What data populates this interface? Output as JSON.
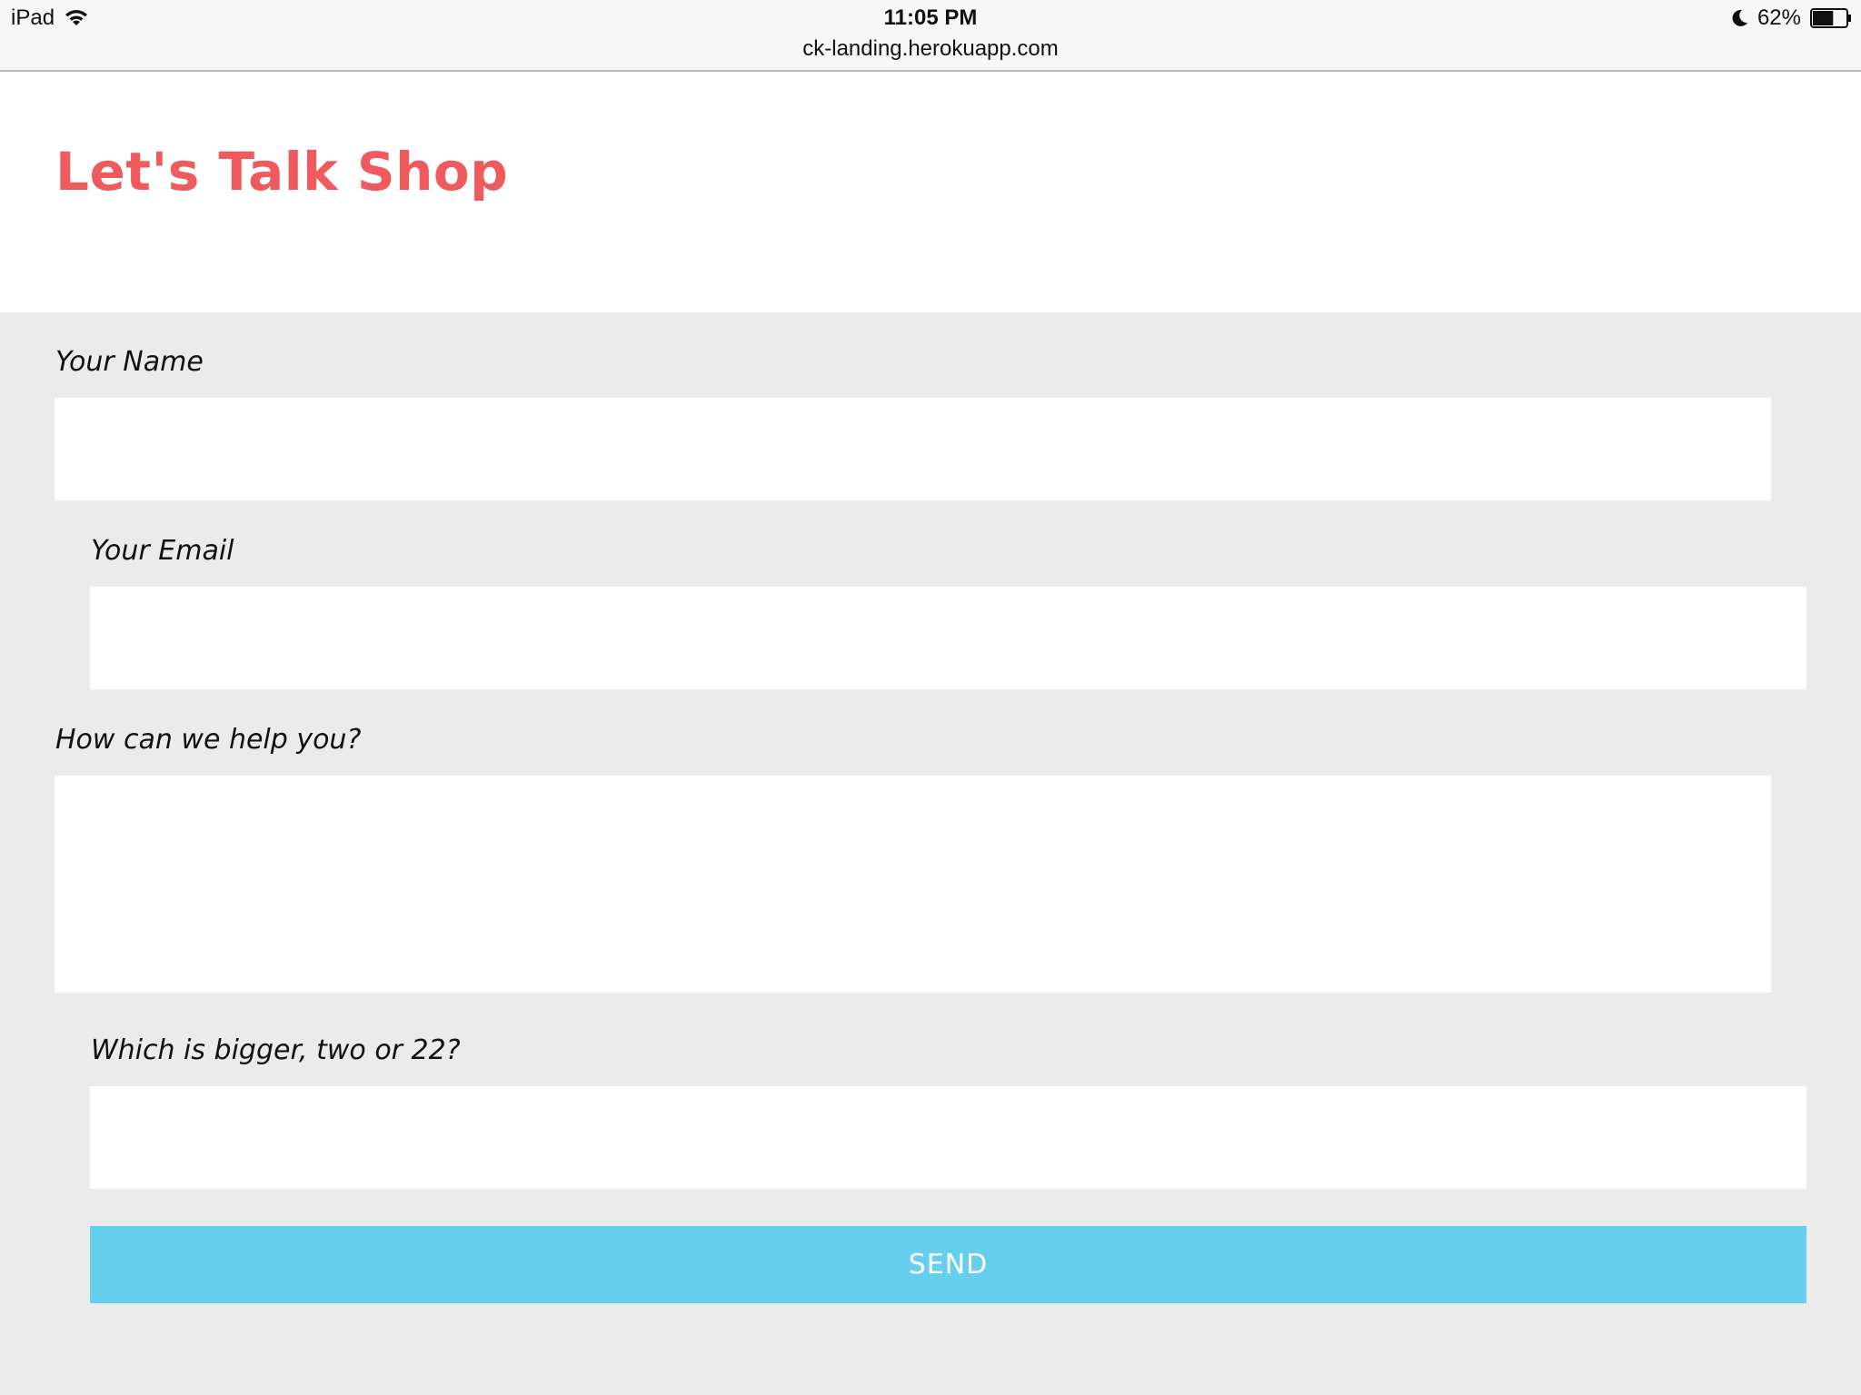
{
  "status_bar": {
    "device": "iPad",
    "time": "11:05 PM",
    "battery": "62%",
    "battery_level": 0.62,
    "icons": [
      "wifi-icon",
      "moon-icon",
      "battery-icon"
    ]
  },
  "browser": {
    "url": "ck-landing.herokuapp.com"
  },
  "page": {
    "title": "Let's Talk Shop",
    "colors": {
      "title": "#ee5a5e",
      "section_bg": "#ebebeb",
      "button_bg": "#66cfee"
    }
  },
  "form": {
    "name_label": "Your Name",
    "name_value": "",
    "email_label": "Your Email",
    "email_value": "",
    "message_label": "How can we help you?",
    "message_value": "",
    "captcha_label": "Which is bigger, two or 22?",
    "captcha_value": "",
    "send_label": "SEND"
  }
}
